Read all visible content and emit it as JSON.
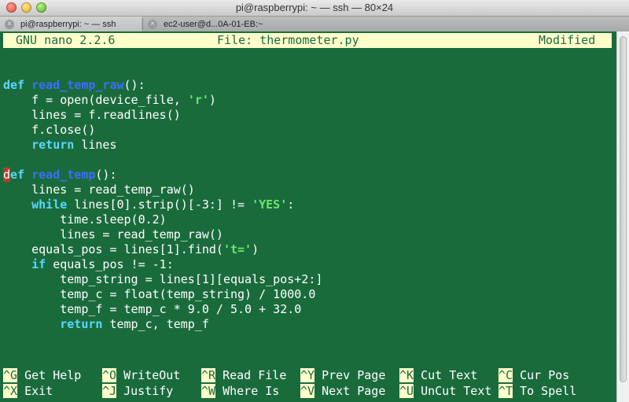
{
  "window": {
    "title": "pi@raspberrypi: ~ — ssh — 80×24",
    "tabs": [
      {
        "label": "pi@raspberrypi: ~ — ssh"
      },
      {
        "label": "ec2-user@d...0A-01-EB:~"
      }
    ],
    "close_glyph": "×"
  },
  "nano": {
    "version": "GNU nano 2.2.6",
    "file": "File: thermometer.py",
    "status": "Modified"
  },
  "code": {
    "l1": {
      "kw": "def",
      "fn": "read_temp_raw",
      "rest": "():"
    },
    "l2": "    f = open(device_file, ",
    "l2_str": "'r'",
    "l2_end": ")",
    "l3": "    lines = f.readlines()",
    "l4": "    f.close()",
    "l5_kw": "return",
    "l5_rest": " lines",
    "l6_cursor": "d",
    "l6_kw": "ef",
    "l6_fn": "read_temp",
    "l6_rest": "():",
    "l7": "    lines = read_temp_raw()",
    "l8_kw": "while",
    "l8_mid": " lines[0].strip()[-3:] != ",
    "l8_str": "'YES'",
    "l8_end": ":",
    "l9": "        time.sleep(0.2)",
    "l10": "        lines = read_temp_raw()",
    "l11": "    equals_pos = lines[1].find(",
    "l11_str": "'t='",
    "l11_end": ")",
    "l12_kw": "if",
    "l12_rest": " equals_pos != -1:",
    "l13": "        temp_string = lines[1][equals_pos+2:]",
    "l14": "        temp_c = float(temp_string) / 1000.0",
    "l15": "        temp_f = temp_c * 9.0 / 5.0 + 32.0",
    "l16_kw": "return",
    "l16_rest": " temp_c, temp_f"
  },
  "shortcuts": {
    "row1": [
      {
        "key": "^G",
        "label": "Get Help"
      },
      {
        "key": "^O",
        "label": "WriteOut"
      },
      {
        "key": "^R",
        "label": "Read File"
      },
      {
        "key": "^Y",
        "label": "Prev Page"
      },
      {
        "key": "^K",
        "label": "Cut Text"
      },
      {
        "key": "^C",
        "label": "Cur Pos"
      }
    ],
    "row2": [
      {
        "key": "^X",
        "label": "Exit"
      },
      {
        "key": "^J",
        "label": "Justify"
      },
      {
        "key": "^W",
        "label": "Where Is"
      },
      {
        "key": "^V",
        "label": "Next Page"
      },
      {
        "key": "^U",
        "label": "UnCut Text"
      },
      {
        "key": "^T",
        "label": "To Spell"
      }
    ]
  }
}
